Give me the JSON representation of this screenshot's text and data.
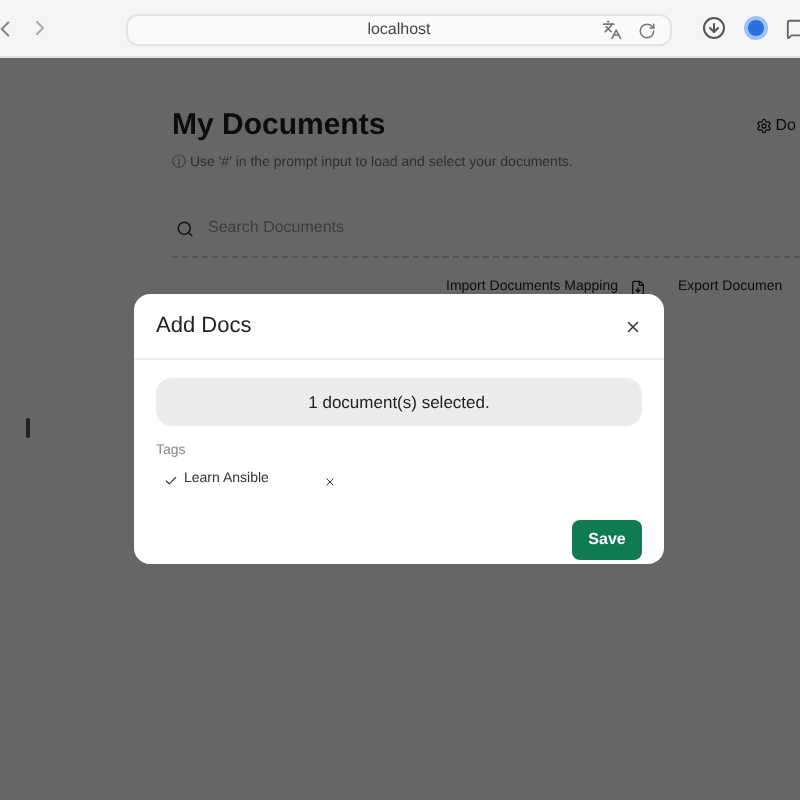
{
  "browser": {
    "url": "localhost"
  },
  "page": {
    "title": "My Documents",
    "hint": "ⓘ Use '#' in the prompt input to load and select your documents.",
    "settings_button": "Do",
    "search": {
      "placeholder": "Search Documents"
    },
    "actions": [
      "Import Documents Mapping",
      "Export Documen"
    ]
  },
  "dialog": {
    "title": "Add Docs",
    "selection_summary": "1 document(s) selected.",
    "tags_label": "Tags",
    "tags": [
      {
        "label": "Learn Ansible",
        "checked": true
      }
    ],
    "save_button": "Save"
  }
}
